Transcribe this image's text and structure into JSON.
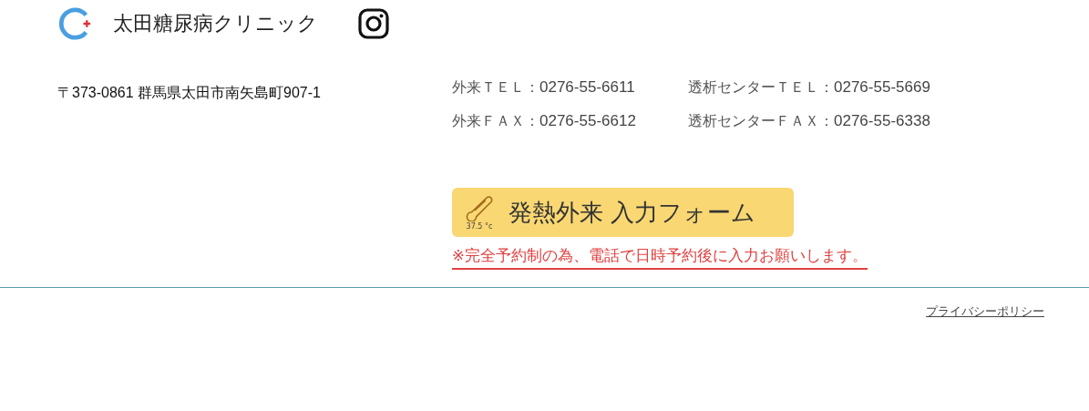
{
  "header": {
    "clinic_name": "太田糖尿病クリニック"
  },
  "address": "〒373-0861  群馬県太田市南矢島町907-1",
  "contacts": [
    {
      "label": "外来ＴＥＬ：",
      "number": "0276-55-6611"
    },
    {
      "label": "透析センターＴＥＬ：",
      "number": "0276-55-5669"
    },
    {
      "label": "外来ＦＡＸ：",
      "number": "0276-55-6612"
    },
    {
      "label": "透析センターＦＡＸ：",
      "number": "0276-55-6338"
    }
  ],
  "fever_button": {
    "label": "発熱外来 入力フォーム",
    "thermometer_reading": "37.5 °c"
  },
  "notice": "※完全予約制の為、電話で日時予約後に入力お願いします。",
  "footer": {
    "privacy_link": "プライバシーポリシー"
  }
}
